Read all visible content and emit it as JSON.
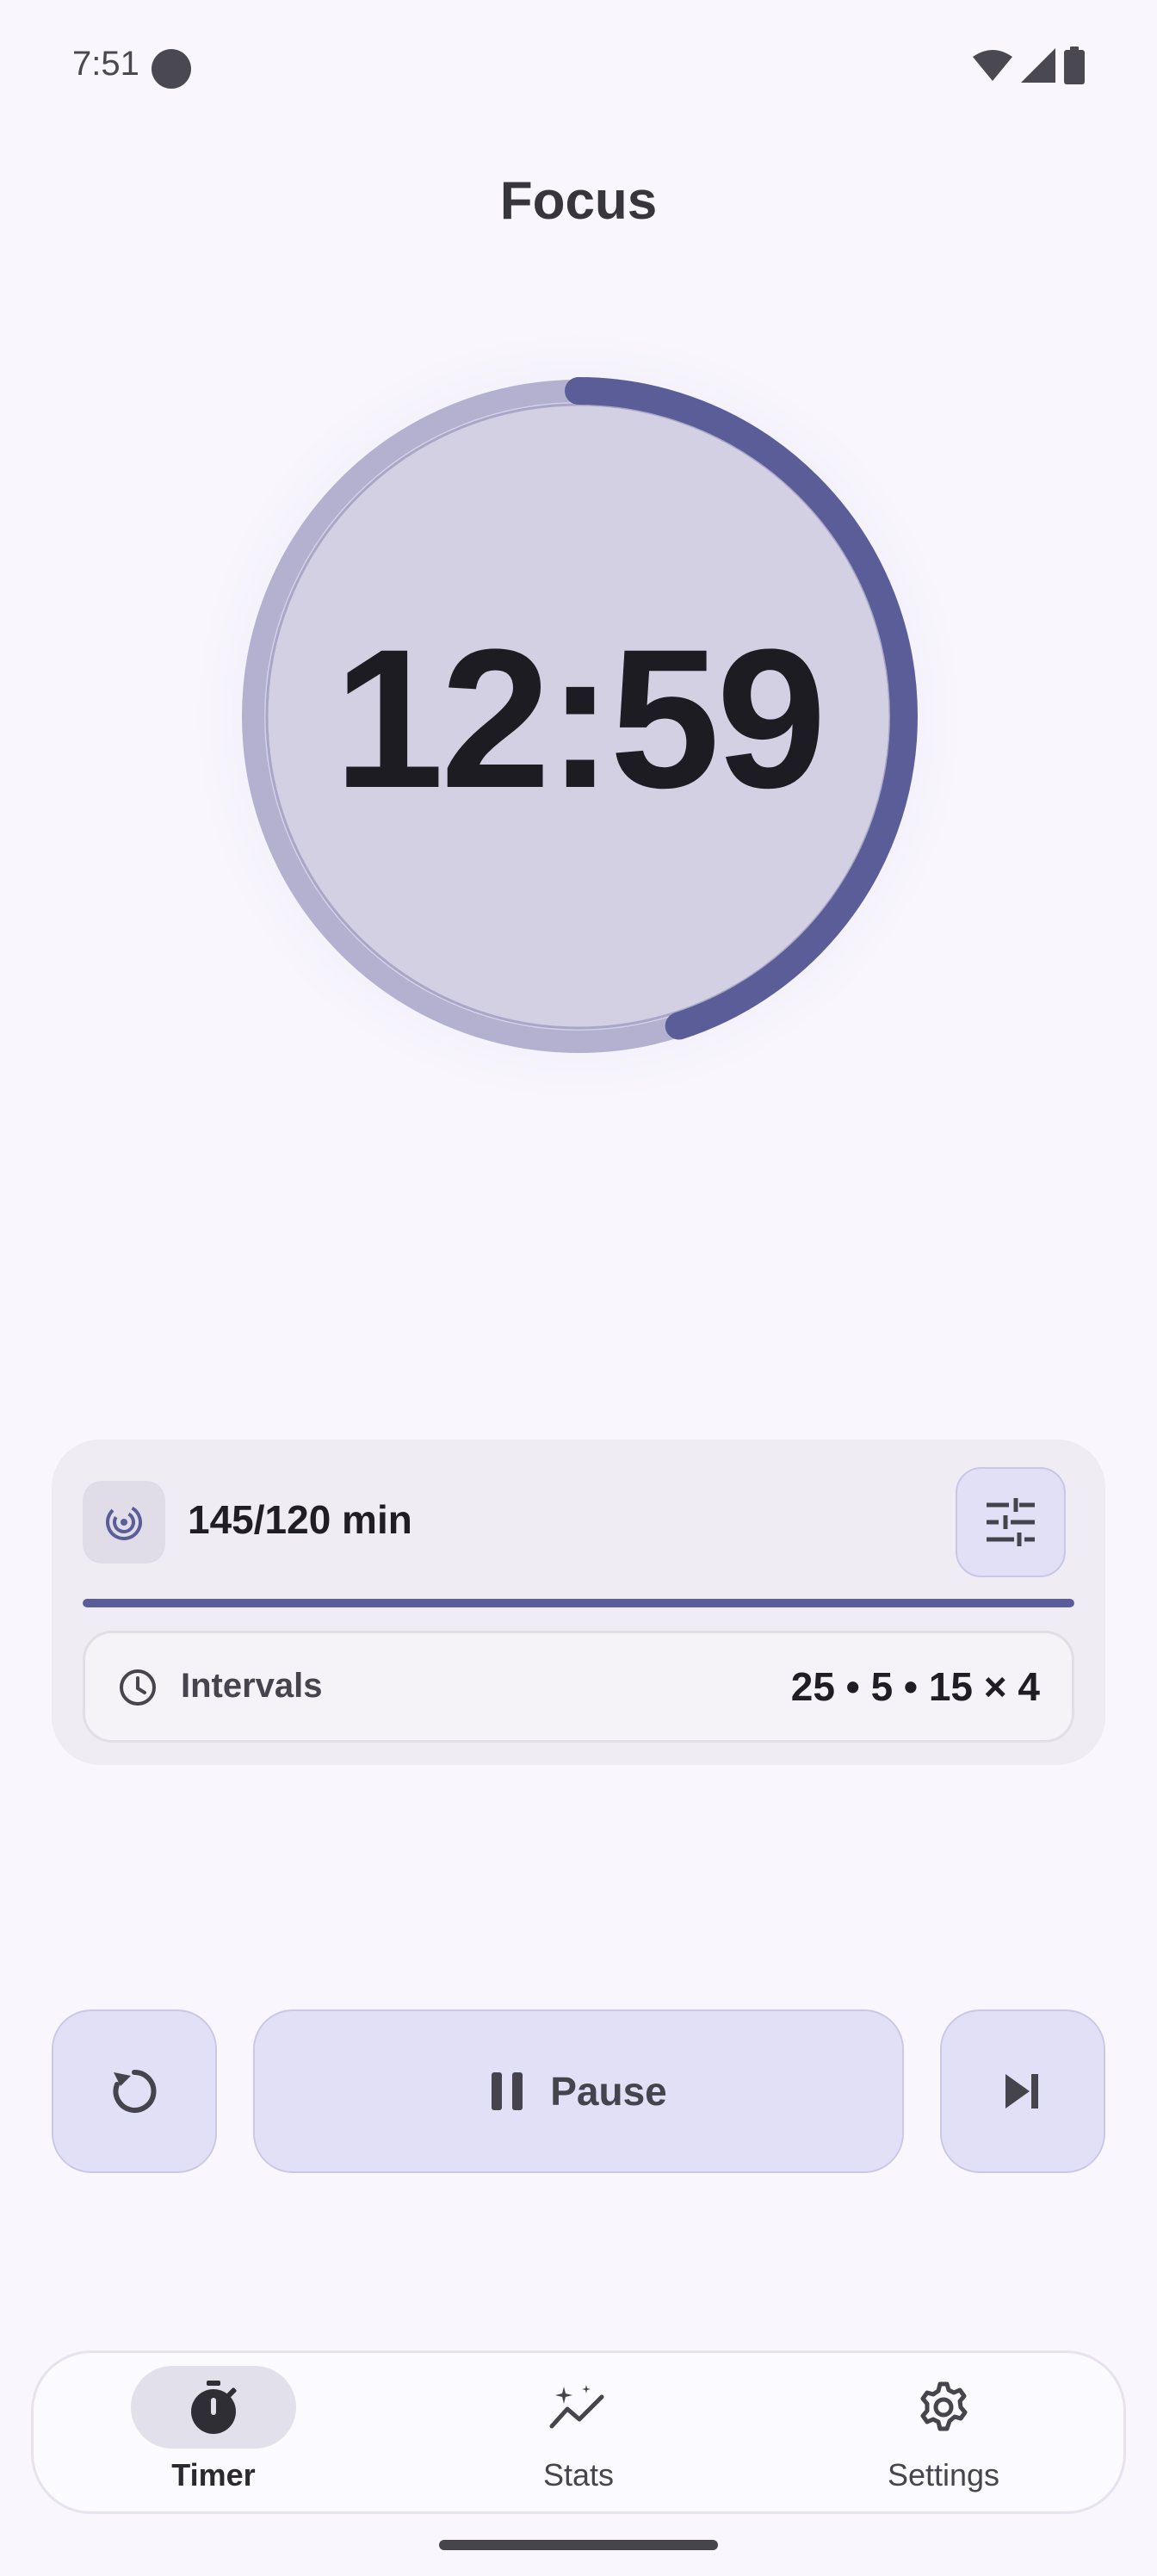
{
  "status_bar": {
    "time": "7:51"
  },
  "title": "Focus",
  "timer": {
    "display": "12:59",
    "progress": 0.45
  },
  "goal": {
    "text": "145/120 min",
    "progress": 1.0
  },
  "intervals": {
    "label": "Intervals",
    "value": "25 • 5 • 15 × 4"
  },
  "controls": {
    "pause_label": "Pause"
  },
  "nav": {
    "items": [
      {
        "label": "Timer",
        "icon": "timer-icon",
        "active": true
      },
      {
        "label": "Stats",
        "icon": "stats-icon",
        "active": false
      },
      {
        "label": "Settings",
        "icon": "gear-icon",
        "active": false
      }
    ]
  },
  "colors": {
    "accent": "#5b5d98",
    "button_bg": "#e2e0f7",
    "background": "#f9f7fd"
  }
}
